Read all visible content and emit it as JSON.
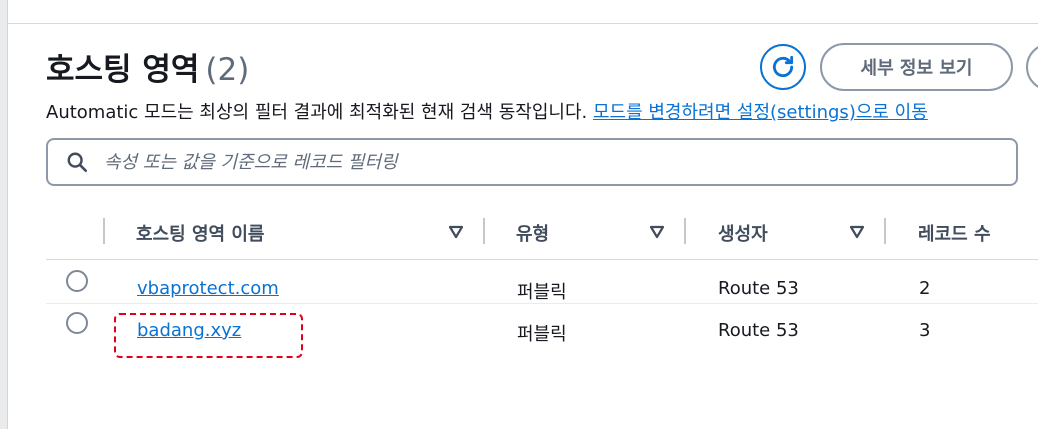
{
  "header": {
    "title": "호스팅 영역",
    "count": "(2)",
    "detail_button": "세부 정보 보기"
  },
  "description": {
    "text": "Automatic 모드는 최상의 필터 결과에 최적화된 현재 검색 동작입니다. ",
    "link": "모드를 변경하려면 설정(settings)으로 이동"
  },
  "search": {
    "placeholder": "속성 또는 값을 기준으로 레코드 필터링"
  },
  "table": {
    "columns": [
      "호스팅 영역 이름",
      "유형",
      "생성자",
      "레코드 수"
    ],
    "rows": [
      {
        "name": "vbaprotect.com",
        "type": "퍼블릭",
        "created_by": "Route 53",
        "record_count": "2"
      },
      {
        "name": "badang.xyz",
        "type": "퍼블릭",
        "created_by": "Route 53",
        "record_count": "3"
      }
    ]
  },
  "colors": {
    "accent": "#0972d3",
    "highlight": "#e0001b"
  }
}
